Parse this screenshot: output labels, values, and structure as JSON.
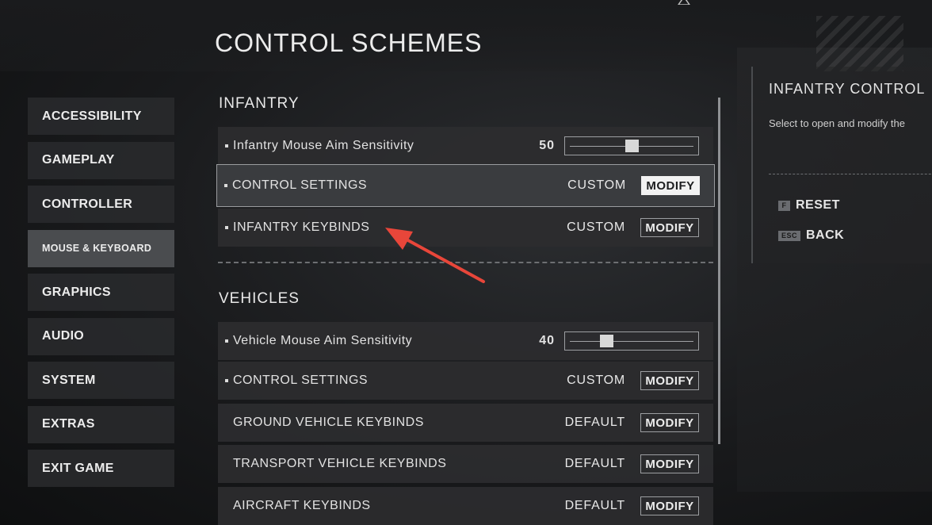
{
  "page": {
    "title": "CONTROL SCHEMES"
  },
  "nav": {
    "items": [
      {
        "label": "ACCESSIBILITY"
      },
      {
        "label": "GAMEPLAY"
      },
      {
        "label": "CONTROLLER"
      },
      {
        "label": "MOUSE & KEYBOARD",
        "active": true
      },
      {
        "label": "GRAPHICS"
      },
      {
        "label": "AUDIO"
      },
      {
        "label": "SYSTEM"
      },
      {
        "label": "EXTRAS"
      },
      {
        "label": "EXIT GAME"
      }
    ]
  },
  "infantry": {
    "title": "INFANTRY",
    "sensitivity": {
      "label": "Infantry Mouse Aim Sensitivity",
      "value": "50",
      "level": 0.5
    },
    "control_settings": {
      "label": "CONTROL SETTINGS",
      "status": "CUSTOM",
      "button": "MODIFY"
    },
    "keybinds": {
      "label": "INFANTRY KEYBINDS",
      "status": "CUSTOM",
      "button": "MODIFY"
    }
  },
  "vehicles": {
    "title": "VEHICLES",
    "sensitivity": {
      "label": "Vehicle Mouse Aim Sensitivity",
      "value": "40",
      "level": 0.3
    },
    "control_settings": {
      "label": "CONTROL SETTINGS",
      "status": "CUSTOM",
      "button": "MODIFY"
    },
    "ground": {
      "label": "GROUND VEHICLE KEYBINDS",
      "status": "DEFAULT",
      "button": "MODIFY"
    },
    "transport": {
      "label": "TRANSPORT VEHICLE KEYBINDS",
      "status": "DEFAULT",
      "button": "MODIFY"
    },
    "aircraft": {
      "label": "AIRCRAFT KEYBINDS",
      "status": "DEFAULT",
      "button": "MODIFY"
    }
  },
  "info_panel": {
    "title": "INFANTRY CONTROL",
    "description": "Select to open and modify the",
    "hints": [
      {
        "key": "F",
        "label": "RESET"
      },
      {
        "key": "ESC",
        "label": "BACK"
      }
    ]
  },
  "colors": {
    "arrow": "#e8463a",
    "highlight": "#f2f2f2"
  }
}
